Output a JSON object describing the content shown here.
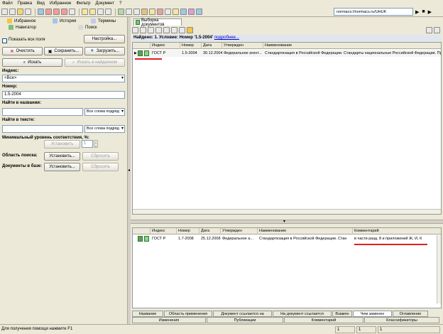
{
  "menu": [
    "Файл",
    "Правка",
    "Вид",
    "Избранное",
    "Фильтр",
    "Документ",
    "?"
  ],
  "address": "normacs://normacs.ru/UHUK",
  "left": {
    "tabs": {
      "favorites": "Избранное",
      "history": "История",
      "terms": "Термины",
      "navigator": "Навигатор",
      "search": "Поиск"
    },
    "show_all_fields": "Показать все поля",
    "settings_button": "Настройка...",
    "clear_button": "Очистить",
    "save_button": "Сохранить...",
    "load_button": "Загрузить...",
    "search_button": "Искать",
    "search_in_found_button": "Искать в найденном",
    "index_label": "Индекс:",
    "index_value": "<Все>",
    "number_label": "Номер:",
    "number_value": "1.5-2004",
    "find_in_title_label": "Найти в названии:",
    "find_in_title_mode": "Все слова подряд",
    "find_in_text_label": "Найти в тексте:",
    "find_in_text_mode": "Все слова подряд",
    "min_relevance_label": "Минимальный уровень соответствия, %:",
    "set_button": "Установить",
    "min_relevance_value": "1",
    "search_area_label": "Область поиска:",
    "search_area_set": "Установить...",
    "search_area_reset": "Сбросить",
    "docs_in_base_label": "Документы в базе:",
    "docs_set": "Установить...",
    "docs_reset": "Сбросить"
  },
  "right": {
    "doc_tab": "Выборка документов",
    "found_prefix": "Найдено: 1. Условие: Номер ",
    "found_query": "'1.5-2004'",
    "found_more": "подробнее...",
    "top_grid": {
      "headers": [
        "Индекс",
        "Номер",
        "Дата",
        "Утвержден",
        "Наименование"
      ],
      "rows": [
        {
          "index": "ГОСТ Р",
          "number": "1.5-2004",
          "date": "30.12.2004",
          "approved": "Федеральное агент...",
          "title": "Стандартизация в Российской Федерации. Стандарты национальные Российской Федерации. Пра"
        }
      ]
    },
    "bottom_grid": {
      "headers": [
        "Индекс",
        "Номер",
        "Дата",
        "Утвержден",
        "Наименование",
        "Комментарий"
      ],
      "rows": [
        {
          "index": "ГОСТ Р",
          "number": "1.7-2008",
          "date": "25.12.2008",
          "approved": "Федеральное а...",
          "title": "Стандартизация в Российской Федерации. Стан",
          "comment": "в части разд. 8 и приложений Ж, И, К"
        }
      ]
    },
    "bottom_tabs_row1": [
      "Название",
      "Область применения",
      "Документ ссылается на",
      "На документ ссылается",
      "Взамен",
      "Чем заменен",
      "Оглавление"
    ],
    "bottom_tabs_row2": [
      "Изменения",
      "Публикации",
      "Комментарий",
      "Классификаторы"
    ]
  },
  "status": {
    "hint": "Для получения помощи нажмите F1",
    "box1": "1",
    "box2": "1",
    "box3": "1"
  }
}
